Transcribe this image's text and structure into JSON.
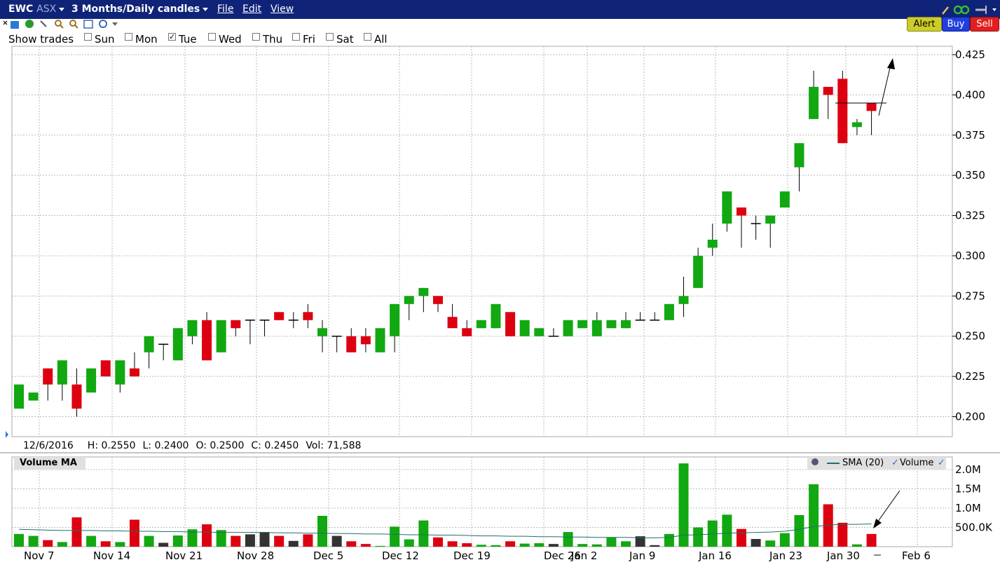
{
  "window": {
    "symbol": "EWC",
    "exchange": "ASX",
    "period": "3 Months/Daily candles",
    "menu": [
      "File",
      "Edit",
      "View"
    ]
  },
  "actions": {
    "alert": "Alert",
    "buy": "Buy",
    "sell": "Sell"
  },
  "show_trades": {
    "label": "Show trades",
    "days": [
      {
        "label": "Sun",
        "checked": false
      },
      {
        "label": "Mon",
        "checked": false
      },
      {
        "label": "Tue",
        "checked": true
      },
      {
        "label": "Wed",
        "checked": false
      },
      {
        "label": "Thu",
        "checked": false
      },
      {
        "label": "Fri",
        "checked": false
      },
      {
        "label": "Sat",
        "checked": false
      },
      {
        "label": "All",
        "checked": false
      }
    ]
  },
  "info": {
    "date": "12/6/2016",
    "high": "H: 0.2550",
    "low": "L: 0.2400",
    "open": "O: 0.2500",
    "close": "C: 0.2450",
    "volume": "Vol: 71,588"
  },
  "volume_panel": {
    "title": "Volume MA",
    "legend_sma": "SMA (20)",
    "legend_volume": "Volume"
  },
  "colors": {
    "up": "#11a811",
    "down": "#dd0010",
    "neutral": "#333333",
    "sma": "#1f6f6f",
    "titlebar": "#0f2378"
  },
  "chart_data": {
    "type": "candlestick",
    "x_ticks": [
      "Nov 7",
      "Nov 14",
      "Nov 21",
      "Nov 28",
      "Dec 5",
      "Dec 12",
      "Dec 19",
      "Dec 26",
      "Jan 2",
      "Jan 9",
      "Jan 16",
      "Jan 23",
      "Jan 30",
      "Feb 6"
    ],
    "y_ticks": [
      "0.425",
      "0.400",
      "0.375",
      "0.350",
      "0.325",
      "0.300",
      "0.275",
      "0.250",
      "0.225",
      "0.200"
    ],
    "ylim": [
      0.19,
      0.428
    ],
    "volume_ticks": [
      "2.0M",
      "1.5M",
      "1.0M",
      "500.0K"
    ],
    "volume_ylim": [
      0,
      2.2
    ],
    "candles": [
      {
        "o": 0.205,
        "h": 0.22,
        "l": 0.205,
        "c": 0.22,
        "v": 0.33
      },
      {
        "o": 0.21,
        "h": 0.215,
        "l": 0.21,
        "c": 0.215,
        "v": 0.28
      },
      {
        "o": 0.23,
        "h": 0.23,
        "l": 0.21,
        "c": 0.22,
        "v": 0.17
      },
      {
        "o": 0.22,
        "h": 0.235,
        "l": 0.21,
        "c": 0.235,
        "v": 0.12
      },
      {
        "o": 0.22,
        "h": 0.23,
        "l": 0.2,
        "c": 0.205,
        "v": 0.76
      },
      {
        "o": 0.215,
        "h": 0.23,
        "l": 0.215,
        "c": 0.23,
        "v": 0.28
      },
      {
        "o": 0.235,
        "h": 0.235,
        "l": 0.225,
        "c": 0.225,
        "v": 0.14
      },
      {
        "o": 0.22,
        "h": 0.235,
        "l": 0.215,
        "c": 0.235,
        "v": 0.12
      },
      {
        "o": 0.23,
        "h": 0.24,
        "l": 0.225,
        "c": 0.225,
        "v": 0.7
      },
      {
        "o": 0.24,
        "h": 0.25,
        "l": 0.23,
        "c": 0.25,
        "v": 0.28
      },
      {
        "o": 0.245,
        "h": 0.245,
        "l": 0.235,
        "c": 0.245,
        "v": 0.1
      },
      {
        "o": 0.235,
        "h": 0.255,
        "l": 0.235,
        "c": 0.255,
        "v": 0.29
      },
      {
        "o": 0.25,
        "h": 0.26,
        "l": 0.245,
        "c": 0.26,
        "v": 0.45
      },
      {
        "o": 0.26,
        "h": 0.265,
        "l": 0.235,
        "c": 0.235,
        "v": 0.58
      },
      {
        "o": 0.24,
        "h": 0.26,
        "l": 0.24,
        "c": 0.26,
        "v": 0.43
      },
      {
        "o": 0.26,
        "h": 0.26,
        "l": 0.25,
        "c": 0.255,
        "v": 0.28
      },
      {
        "o": 0.26,
        "h": 0.26,
        "l": 0.245,
        "c": 0.26,
        "v": 0.32
      },
      {
        "o": 0.26,
        "h": 0.26,
        "l": 0.25,
        "c": 0.26,
        "v": 0.38
      },
      {
        "o": 0.265,
        "h": 0.265,
        "l": 0.26,
        "c": 0.26,
        "v": 0.28
      },
      {
        "o": 0.26,
        "h": 0.265,
        "l": 0.255,
        "c": 0.26,
        "v": 0.15
      },
      {
        "o": 0.265,
        "h": 0.27,
        "l": 0.255,
        "c": 0.26,
        "v": 0.32
      },
      {
        "o": 0.25,
        "h": 0.26,
        "l": 0.24,
        "c": 0.255,
        "v": 0.8
      },
      {
        "o": 0.25,
        "h": 0.25,
        "l": 0.24,
        "c": 0.25,
        "v": 0.28
      },
      {
        "o": 0.25,
        "h": 0.255,
        "l": 0.24,
        "c": 0.24,
        "v": 0.14
      },
      {
        "o": 0.25,
        "h": 0.255,
        "l": 0.24,
        "c": 0.245,
        "v": 0.07
      },
      {
        "o": 0.24,
        "h": 0.255,
        "l": 0.24,
        "c": 0.255,
        "v": 0.02
      },
      {
        "o": 0.25,
        "h": 0.27,
        "l": 0.24,
        "c": 0.27,
        "v": 0.52
      },
      {
        "o": 0.27,
        "h": 0.275,
        "l": 0.26,
        "c": 0.275,
        "v": 0.19
      },
      {
        "o": 0.275,
        "h": 0.28,
        "l": 0.265,
        "c": 0.28,
        "v": 0.68
      },
      {
        "o": 0.275,
        "h": 0.275,
        "l": 0.265,
        "c": 0.27,
        "v": 0.24
      },
      {
        "o": 0.262,
        "h": 0.27,
        "l": 0.255,
        "c": 0.255,
        "v": 0.14
      },
      {
        "o": 0.255,
        "h": 0.26,
        "l": 0.25,
        "c": 0.25,
        "v": 0.09
      },
      {
        "o": 0.255,
        "h": 0.26,
        "l": 0.255,
        "c": 0.26,
        "v": 0.05
      },
      {
        "o": 0.255,
        "h": 0.27,
        "l": 0.255,
        "c": 0.27,
        "v": 0.04
      },
      {
        "o": 0.265,
        "h": 0.265,
        "l": 0.25,
        "c": 0.25,
        "v": 0.14
      },
      {
        "o": 0.25,
        "h": 0.26,
        "l": 0.25,
        "c": 0.26,
        "v": 0.08
      },
      {
        "o": 0.25,
        "h": 0.255,
        "l": 0.25,
        "c": 0.255,
        "v": 0.09
      },
      {
        "o": 0.25,
        "h": 0.255,
        "l": 0.25,
        "c": 0.25,
        "v": 0.07
      },
      {
        "o": 0.25,
        "h": 0.26,
        "l": 0.25,
        "c": 0.26,
        "v": 0.38
      },
      {
        "o": 0.255,
        "h": 0.26,
        "l": 0.255,
        "c": 0.26,
        "v": 0.07
      },
      {
        "o": 0.25,
        "h": 0.265,
        "l": 0.25,
        "c": 0.26,
        "v": 0.06
      },
      {
        "o": 0.255,
        "h": 0.26,
        "l": 0.255,
        "c": 0.26,
        "v": 0.24
      },
      {
        "o": 0.255,
        "h": 0.265,
        "l": 0.255,
        "c": 0.26,
        "v": 0.14
      },
      {
        "o": 0.26,
        "h": 0.265,
        "l": 0.26,
        "c": 0.26,
        "v": 0.27
      },
      {
        "o": 0.26,
        "h": 0.265,
        "l": 0.26,
        "c": 0.26,
        "v": 0.04
      },
      {
        "o": 0.26,
        "h": 0.27,
        "l": 0.26,
        "c": 0.27,
        "v": 0.33
      },
      {
        "o": 0.27,
        "h": 0.287,
        "l": 0.262,
        "c": 0.275,
        "v": 2.16
      },
      {
        "o": 0.28,
        "h": 0.305,
        "l": 0.28,
        "c": 0.3,
        "v": 0.5
      },
      {
        "o": 0.305,
        "h": 0.32,
        "l": 0.3,
        "c": 0.31,
        "v": 0.68
      },
      {
        "o": 0.32,
        "h": 0.34,
        "l": 0.315,
        "c": 0.34,
        "v": 0.83
      },
      {
        "o": 0.33,
        "h": 0.33,
        "l": 0.305,
        "c": 0.325,
        "v": 0.46
      },
      {
        "o": 0.32,
        "h": 0.325,
        "l": 0.31,
        "c": 0.32,
        "v": 0.2
      },
      {
        "o": 0.32,
        "h": 0.325,
        "l": 0.305,
        "c": 0.325,
        "v": 0.16
      },
      {
        "o": 0.33,
        "h": 0.34,
        "l": 0.33,
        "c": 0.34,
        "v": 0.35
      },
      {
        "o": 0.355,
        "h": 0.37,
        "l": 0.34,
        "c": 0.37,
        "v": 0.82
      },
      {
        "o": 0.385,
        "h": 0.415,
        "l": 0.385,
        "c": 0.405,
        "v": 1.62
      },
      {
        "o": 0.405,
        "h": 0.405,
        "l": 0.385,
        "c": 0.4,
        "v": 1.1
      },
      {
        "o": 0.41,
        "h": 0.415,
        "l": 0.37,
        "c": 0.37,
        "v": 0.62
      },
      {
        "o": 0.38,
        "h": 0.385,
        "l": 0.375,
        "c": 0.383,
        "v": 0.06
      },
      {
        "o": 0.395,
        "h": 0.395,
        "l": 0.375,
        "c": 0.39,
        "v": 0.33
      }
    ],
    "sma": [
      0.45,
      0.44,
      0.43,
      0.42,
      0.42,
      0.42,
      0.41,
      0.41,
      0.4,
      0.4,
      0.39,
      0.39,
      0.38,
      0.38,
      0.37,
      0.37,
      0.37,
      0.37,
      0.36,
      0.36,
      0.35,
      0.35,
      0.34,
      0.34,
      0.33,
      0.33,
      0.32,
      0.31,
      0.31,
      0.3,
      0.3,
      0.29,
      0.28,
      0.28,
      0.27,
      0.27,
      0.26,
      0.26,
      0.25,
      0.25,
      0.24,
      0.24,
      0.24,
      0.23,
      0.23,
      0.24,
      0.3,
      0.31,
      0.33,
      0.35,
      0.36,
      0.37,
      0.38,
      0.4,
      0.45,
      0.52,
      0.56,
      0.58,
      0.58,
      0.59
    ]
  }
}
